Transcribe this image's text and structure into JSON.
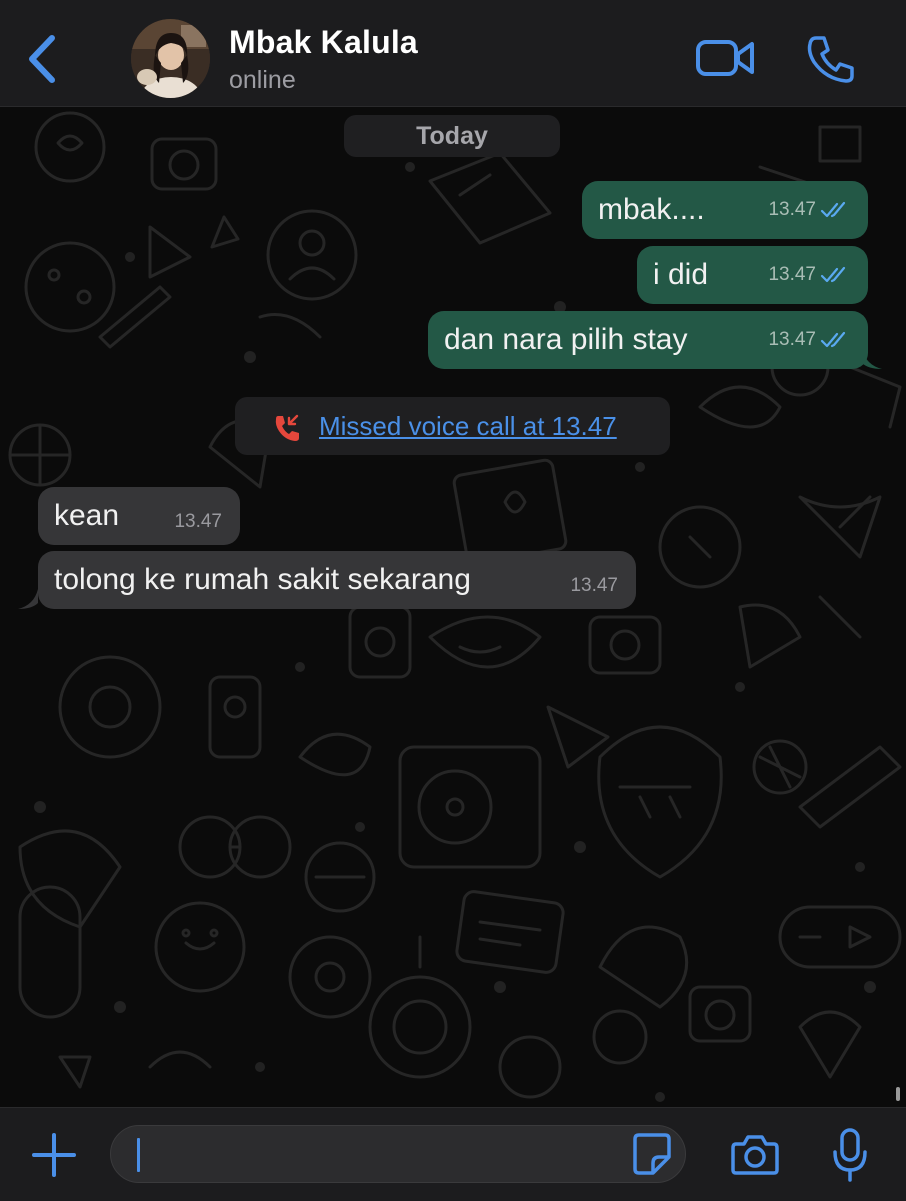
{
  "header": {
    "contact_name": "Mbak Kalula",
    "status": "online",
    "icons": {
      "back": "chevron-left-icon",
      "video": "video-camera-icon",
      "call": "phone-icon"
    },
    "accent_color": "#4a8fe8"
  },
  "chat": {
    "date_label": "Today",
    "messages": [
      {
        "direction": "outgoing",
        "text": "mbak....",
        "time": "13.47",
        "status": "read"
      },
      {
        "direction": "outgoing",
        "text": "i did",
        "time": "13.47",
        "status": "read"
      },
      {
        "direction": "outgoing",
        "text": "dan nara pilih stay",
        "time": "13.47",
        "status": "read"
      },
      {
        "direction": "system",
        "text": "Missed voice call at 13.47",
        "icon": "missed-call-icon"
      },
      {
        "direction": "incoming",
        "text": "kean",
        "time": "13.47"
      },
      {
        "direction": "incoming",
        "text": "tolong ke rumah sakit sekarang",
        "time": "13.47"
      }
    ],
    "colors": {
      "outgoing_bubble": "#235846",
      "incoming_bubble": "#363638",
      "missed_call": "#e5473c",
      "read_ticks": "#5aa9f0"
    }
  },
  "input_bar": {
    "value": "",
    "icons": {
      "attach": "plus-icon",
      "sticker": "sticker-icon",
      "camera": "camera-icon",
      "mic": "microphone-icon"
    }
  }
}
